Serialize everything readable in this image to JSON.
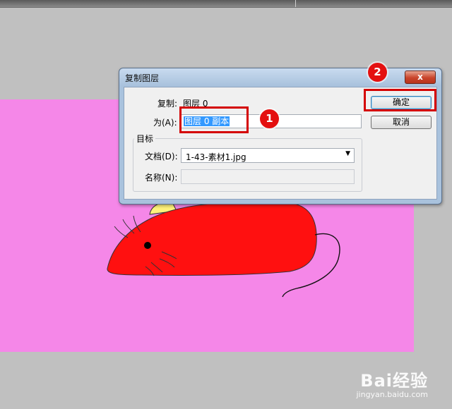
{
  "dialog": {
    "title": "复制图层",
    "close_glyph": "x",
    "duplicate_label": "复制:",
    "duplicate_value": "图层 0",
    "as_label": "为(A):",
    "as_value": "图层 0 副本",
    "destination_legend": "目标",
    "document_label": "文档(D):",
    "document_value": "1-43-素材1.jpg",
    "name_label": "名称(N):",
    "name_value": "",
    "ok_label": "确定",
    "cancel_label": "取消"
  },
  "annotations": {
    "step1": "1",
    "step2": "2",
    "color": "#d40000"
  },
  "watermark": {
    "brand": "Bai经验",
    "url": "jingyan.baidu.com"
  },
  "colors": {
    "canvas_bg": "#f587e8",
    "workspace_bg": "#c0c0c0",
    "mouse_body": "#ff1010",
    "selection": "#3399ff"
  },
  "icons": {
    "dropdown": "chevron-down-icon",
    "close": "close-icon"
  }
}
